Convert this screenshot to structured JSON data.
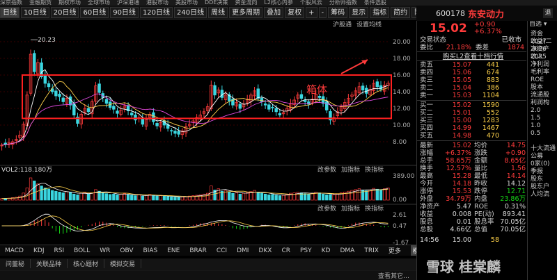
{
  "top_menu": [
    "深京指数",
    "金融期货",
    "期权市场",
    "全球市场",
    "沪深港通",
    "港股市场",
    "美股市场",
    "DDE决策",
    "资金流向",
    "L2核心内参",
    "个股风云",
    "分析师指数",
    "条件选股"
  ],
  "toolbar": {
    "items": [
      "日线",
      "10日线",
      "20日线",
      "60日线",
      "90日线",
      "120日线",
      "240日线",
      "周线",
      "更多周期",
      "叠加",
      "复权",
      "+",
      "-",
      "筹码",
      "显示",
      "指标",
      "简约",
      "隐藏"
    ],
    "selected": 0,
    "sub_right": [
      "沪股通",
      "设置均线"
    ]
  },
  "ticker": {
    "code": "600178",
    "name": "东安动力",
    "back": "退",
    "price": "15.02",
    "change": "+0.90",
    "change_pct": "+6.37%",
    "select_label": "自选"
  },
  "chart_data": {
    "type": "candlestick",
    "y_ticks": [
      "20.00",
      "18.00",
      "16.00",
      "14.00",
      "12.00",
      "10.00",
      "8.00"
    ],
    "ylim": [
      7.0,
      21.5
    ],
    "high_annotation": "20.23",
    "box_label": "箱体",
    "box_range": [
      10.8,
      16.0
    ],
    "closes": [
      7.6,
      7.7,
      7.9,
      8.0,
      8.3,
      8.8,
      10.1,
      13.6,
      18.5,
      16.4,
      17.5,
      15.8,
      15.0,
      14.6,
      14.0,
      13.5,
      13.4,
      12.8,
      13.2,
      12.4,
      11.2,
      10.2,
      11.3,
      12.0,
      11.6,
      12.8,
      14.7,
      13.9,
      13.3,
      12.6,
      12.1,
      11.9,
      11.4,
      11.8,
      12.3,
      11.7,
      11.2,
      10.6,
      10.9,
      10.1,
      10.8,
      11.3,
      10.4,
      9.9,
      10.3,
      10.0,
      9.6,
      9.3,
      9.0,
      8.9,
      9.3,
      9.8,
      10.1,
      10.5,
      10.9,
      11.2,
      11.6,
      12.2,
      14.8,
      13.6,
      14.2,
      13.3,
      13.6,
      12.9,
      12.4,
      12.7,
      12.0,
      12.5,
      13.1,
      13.6,
      14.1,
      13.2,
      12.8,
      12.4,
      11.9,
      12.1,
      11.6,
      11.2,
      11.5,
      12.0,
      12.6,
      13.0,
      13.6,
      13.2,
      12.8,
      12.5,
      13.1,
      13.7,
      13.3,
      12.6,
      11.8,
      10.6,
      10.9,
      11.6,
      12.2,
      12.7,
      13.2,
      13.6,
      14.1,
      14.6,
      14.2,
      13.8,
      14.3,
      15.0,
      14.6,
      14.3,
      14.8,
      15.02
    ],
    "volume_label": "VOL2:118.180万",
    "volume_ticks": [
      "389.00",
      "0.00"
    ],
    "volumes": [
      8,
      9,
      10,
      12,
      14,
      20,
      35,
      60,
      110,
      95,
      80,
      70,
      60,
      55,
      48,
      44,
      40,
      36,
      42,
      38,
      30,
      26,
      34,
      40,
      30,
      36,
      52,
      44,
      38,
      32,
      28,
      30,
      26,
      28,
      32,
      27,
      24,
      22,
      26,
      20,
      24,
      28,
      22,
      20,
      22,
      20,
      18,
      16,
      15,
      14,
      16,
      18,
      20,
      22,
      24,
      26,
      30,
      34,
      70,
      50,
      56,
      44,
      46,
      40,
      34,
      36,
      30,
      34,
      38,
      42,
      48,
      38,
      34,
      30,
      26,
      28,
      24,
      22,
      24,
      28,
      34,
      36,
      40,
      36,
      32,
      30,
      34,
      40,
      36,
      30,
      26,
      28,
      26,
      32,
      36,
      40,
      44,
      48,
      52,
      56,
      50,
      46,
      50,
      58,
      54,
      52,
      56,
      60
    ],
    "macd_ticks": [
      "2.61",
      "0.47",
      "-1.67"
    ],
    "panel_buttons": [
      "改参数",
      "加指标",
      "换指标"
    ]
  },
  "indicator_tabs": [
    "MACD",
    "KDJ",
    "RSI",
    "BOLL",
    "WR",
    "OBV",
    "BIAS",
    "ENE",
    "BRAR",
    "CCI",
    "DMI",
    "DKX",
    "CR",
    "PSY",
    "KD",
    "DMA",
    "TRIX",
    "更多",
    "模板"
  ],
  "bottom_tabs": [
    "问董秘",
    "关联品种",
    "核心题材",
    "模拟交易"
  ],
  "status_right": "查看其它…",
  "orderbook": {
    "state_label": "交易状态",
    "state_value": "已收市",
    "weibi_label": "委比",
    "weibi_value": "21.18%",
    "weicha_label": "委差",
    "weicha_value": "1874",
    "banner": "购买L2查看十档行情",
    "asks": [
      [
        "卖五",
        "15.07",
        "441"
      ],
      [
        "卖四",
        "15.06",
        "674"
      ],
      [
        "卖三",
        "15.05",
        "883"
      ],
      [
        "卖二",
        "15.04",
        "386"
      ],
      [
        "卖一",
        "15.03",
        "1104"
      ]
    ],
    "bids": [
      [
        "买一",
        "15.02",
        "1590"
      ],
      [
        "买二",
        "15.01",
        "552"
      ],
      [
        "买三",
        "15.00",
        "1283"
      ],
      [
        "买四",
        "14.99",
        "1467"
      ],
      [
        "买五",
        "14.98",
        "470"
      ]
    ]
  },
  "stats": [
    [
      "最新",
      "15.02",
      "均价",
      "14.75"
    ],
    [
      "涨幅",
      "+6.37%",
      "涨跌",
      "+0.90"
    ],
    [
      "总手",
      "58.65万",
      "金额",
      "8.65亿"
    ],
    [
      "换手",
      "12.57%",
      "量比",
      "1.56"
    ],
    [
      "最高",
      "15.28",
      "最低",
      "14.14"
    ],
    [
      "今开",
      "14.18",
      "昨收",
      "14.12"
    ],
    [
      "涨停",
      "15.53",
      "跌停",
      "12.71"
    ],
    [
      "外盘",
      "34.79万",
      "内盘",
      "23.86万"
    ],
    [
      "净资产",
      "5.47",
      "ROE",
      "0.31%"
    ],
    [
      "收益",
      "0.008",
      "PE(动)",
      "893.41"
    ],
    [
      "股息",
      "0.01",
      "股息率",
      "70.05亿"
    ],
    [
      "总股",
      "4.66亿",
      "总值",
      "70.05亿"
    ]
  ],
  "tick_row": [
    "14:56",
    "15.00",
    "58"
  ],
  "right_panel": [
    "资金",
    "收益(二",
    "净资产",
    "收入",
    "净利润",
    "毛利率",
    "ROE",
    "股本",
    "流通股",
    "利润构",
    "2.0",
    "1.5",
    "1.0",
    "0.5",
    "",
    "十大流通",
    "公募",
    "0家(0)",
    "季报",
    "股东",
    "股东户",
    "人均流"
  ],
  "right_years": [
    "2027",
    "2026",
    "2025"
  ],
  "watermark": "雪球 桂棠麟"
}
